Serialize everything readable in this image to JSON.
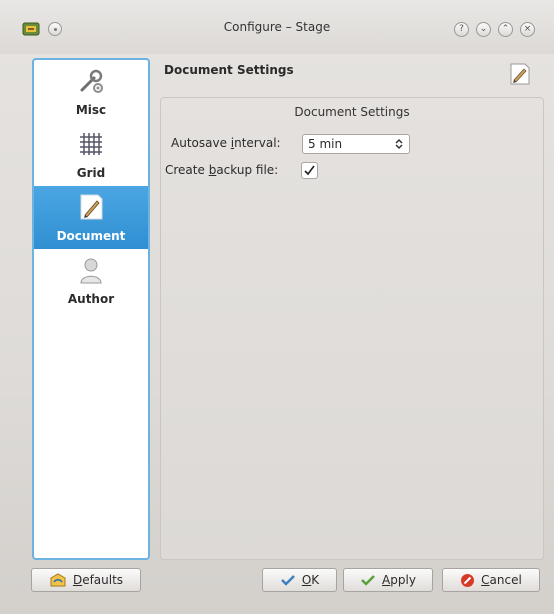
{
  "window": {
    "title": "Configure – Stage"
  },
  "titlebar_buttons": [
    "?",
    "⌄",
    "⌃",
    "×"
  ],
  "sidebar": {
    "items": [
      {
        "label": "Misc",
        "icon": "wrench-icon",
        "active": false
      },
      {
        "label": "Grid",
        "icon": "grid-icon",
        "active": false
      },
      {
        "label": "Document",
        "icon": "document-pen-icon",
        "active": true
      },
      {
        "label": "Author",
        "icon": "user-icon",
        "active": false
      }
    ]
  },
  "page": {
    "title": "Document Settings",
    "group_title": "Document Settings",
    "autosave": {
      "label_pre": "Autosave ",
      "label_mnemonic": "i",
      "label_post": "nterval:",
      "value": "5 min"
    },
    "backup": {
      "label_pre": "Create ",
      "label_mnemonic": "b",
      "label_post": "ackup file:",
      "checked": true
    }
  },
  "buttons": {
    "defaults": {
      "pre": "",
      "mnemonic": "D",
      "post": "efaults"
    },
    "ok": {
      "pre": "",
      "mnemonic": "O",
      "post": "K"
    },
    "apply": {
      "pre": "",
      "mnemonic": "A",
      "post": "pply"
    },
    "cancel": {
      "pre": "",
      "mnemonic": "C",
      "post": "ancel"
    }
  },
  "colors": {
    "accent": "#3a9ad9",
    "sidebar_border": "#6bb3e0",
    "cancel_icon": "#d63b2a",
    "ok_icon": "#3f7fbf",
    "apply_icon": "#5aa03c"
  }
}
